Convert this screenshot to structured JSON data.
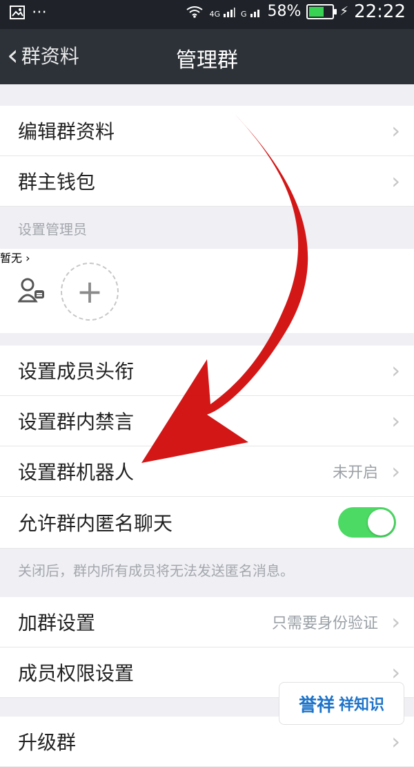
{
  "status_bar": {
    "left_icons": [
      "image-icon",
      "more-icon"
    ],
    "signal_labels": [
      "4G",
      "G"
    ],
    "battery_percent": "58%",
    "time": "22:22",
    "charging": true
  },
  "nav": {
    "back_label": "群资料",
    "title": "管理群"
  },
  "menu": {
    "edit_group_info": "编辑群资料",
    "group_wallet": "群主钱包",
    "set_admin_section": "设置管理员",
    "admin_value": "暂无",
    "set_member_title": "设置成员头衔",
    "group_mute": "设置群内禁言",
    "group_bot": "设置群机器人",
    "group_bot_value": "未开启",
    "anon_chat": "允许群内匿名聊天",
    "anon_note": "关闭后，群内所有成员将无法发送匿名消息。",
    "join_settings": "加群设置",
    "join_settings_value": "只需要身份验证",
    "member_permissions": "成员权限设置",
    "upgrade_group": "升级群"
  },
  "toggles": {
    "anon_chat_on": true
  },
  "watermark": {
    "text1": "誉祥",
    "text2": "祥知识"
  }
}
